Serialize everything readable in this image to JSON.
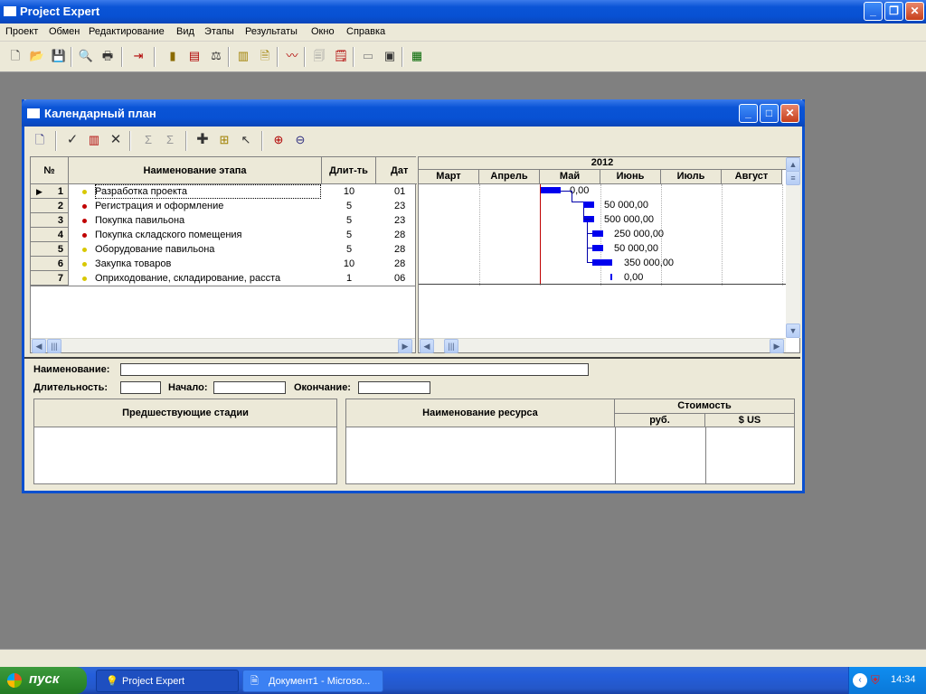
{
  "app": {
    "title": "Project Expert"
  },
  "menu": [
    "Проект",
    "Обмен",
    "Редактирование",
    "Вид",
    "Этапы",
    "Результаты",
    "Окно",
    "Справка"
  ],
  "window": {
    "title": "Календарный план"
  },
  "table": {
    "headers": {
      "num": "№",
      "name": "Наименование этапа",
      "dur": "Длит-ть",
      "date": "Дат"
    },
    "rows": [
      {
        "num": "1",
        "name": "Разработка проекта",
        "dur": "10",
        "date": "01",
        "dot": "#d8c800"
      },
      {
        "num": "2",
        "name": "Регистрация и оформление",
        "dur": "5",
        "date": "23",
        "dot": "#c00000"
      },
      {
        "num": "3",
        "name": "Покупка павильона",
        "dur": "5",
        "date": "23",
        "dot": "#c00000"
      },
      {
        "num": "4",
        "name": "Покупка складского помещения",
        "dur": "5",
        "date": "28",
        "dot": "#c00000"
      },
      {
        "num": "5",
        "name": "Оборудование павильона",
        "dur": "5",
        "date": "28",
        "dot": "#d8c800"
      },
      {
        "num": "6",
        "name": "Закупка товаров",
        "dur": "10",
        "date": "28",
        "dot": "#d8c800"
      },
      {
        "num": "7",
        "name": "Оприходование, складирование, расста",
        "dur": "1",
        "date": "06",
        "dot": "#d8c800"
      }
    ]
  },
  "gantt": {
    "year": "2012",
    "months": [
      "Март",
      "Апрель",
      "Май",
      "Июнь",
      "Июль",
      "Август"
    ],
    "costs": [
      "0,00",
      "50 000,00",
      "500 000,00",
      "250 000,00",
      "50 000,00",
      "350 000,00",
      "0,00"
    ]
  },
  "details": {
    "name_label": "Наименование:",
    "duration_label": "Длительность:",
    "start_label": "Начало:",
    "end_label": "Окончание:",
    "predecessors_header": "Предшествующие стадии",
    "resource_header": "Наименование ресурса",
    "cost_header": "Стоимость",
    "rub_header": "руб.",
    "usd_header": "$ US"
  },
  "taskbar": {
    "start": "пуск",
    "tasks": [
      "Project Expert",
      "Документ1 - Microso..."
    ],
    "time": "14:34"
  },
  "colors": {
    "accent": "#0a54d6",
    "bar": "#0000ee",
    "today_line": "#c00000"
  }
}
